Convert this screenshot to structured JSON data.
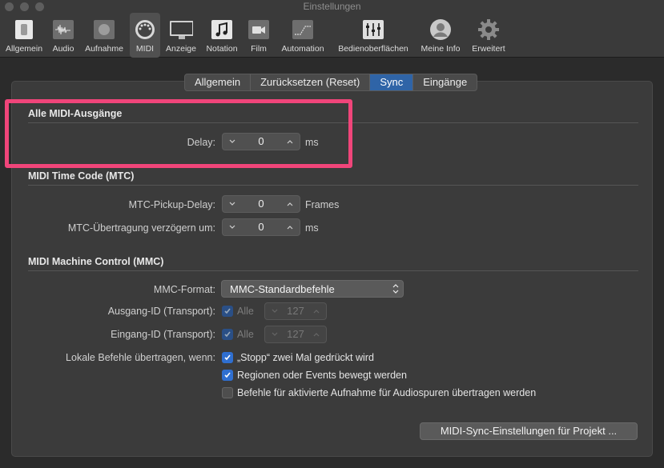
{
  "window": {
    "title": "Einstellungen"
  },
  "toolbar": {
    "items": [
      {
        "label": "Allgemein",
        "icon": "switch-icon"
      },
      {
        "label": "Audio",
        "icon": "waveform-icon"
      },
      {
        "label": "Aufnahme",
        "icon": "record-icon"
      },
      {
        "label": "MIDI",
        "icon": "midi-icon"
      },
      {
        "label": "Anzeige",
        "icon": "monitor-icon"
      },
      {
        "label": "Notation",
        "icon": "note-icon"
      },
      {
        "label": "Film",
        "icon": "film-icon"
      },
      {
        "label": "Automation",
        "icon": "automation-icon"
      },
      {
        "label": "Bedienoberflächen",
        "icon": "mixer-icon"
      },
      {
        "label": "Meine Info",
        "icon": "user-icon"
      },
      {
        "label": "Erweitert",
        "icon": "gear-icon"
      }
    ],
    "active": "MIDI"
  },
  "tabs": [
    {
      "label": "Allgemein"
    },
    {
      "label": "Zurücksetzen (Reset)"
    },
    {
      "label": "Sync"
    },
    {
      "label": "Eingänge"
    }
  ],
  "selected_tab": "Sync",
  "sections": {
    "outputs": {
      "title": "Alle MIDI-Ausgänge",
      "delay_label": "Delay:",
      "delay_value": "0",
      "delay_unit": "ms"
    },
    "mtc": {
      "title": "MIDI Time Code (MTC)",
      "pickup_label": "MTC-Pickup-Delay:",
      "pickup_value": "0",
      "pickup_unit": "Frames",
      "transmit_label": "MTC-Übertragung verzögern um:",
      "transmit_value": "0",
      "transmit_unit": "ms"
    },
    "mmc": {
      "title": "MIDI Machine Control (MMC)",
      "format_label": "MMC-Format:",
      "format_value": "MMC-Standardbefehle",
      "out_id_label": "Ausgang-ID (Transport):",
      "out_id_all": "Alle",
      "out_id_value": "127",
      "in_id_label": "Eingang-ID (Transport):",
      "in_id_all": "Alle",
      "in_id_value": "127",
      "local_label": "Lokale Befehle übertragen, wenn:",
      "opt_stop": "„Stopp“ zwei Mal gedrückt wird",
      "opt_regions": "Regionen oder Events bewegt werden",
      "opt_record": "Befehle für aktivierte Aufnahme für Audiospuren übertragen werden"
    }
  },
  "footer_button": "MIDI-Sync-Einstellungen für Projekt ...",
  "colors": {
    "accent": "#2f64a7",
    "highlight": "#f0457a",
    "checkbox": "#2f6fd0"
  }
}
